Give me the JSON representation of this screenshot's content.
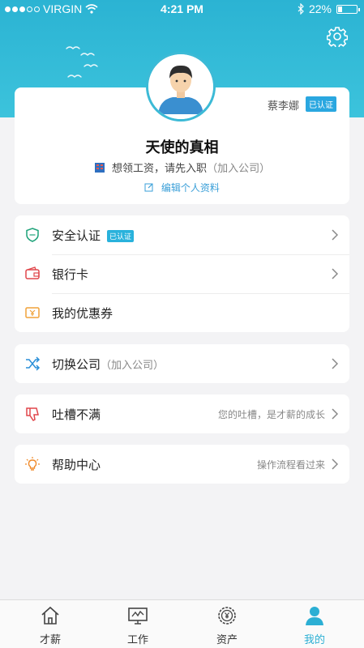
{
  "status_bar": {
    "carrier": "VIRGIN",
    "time": "4:21 PM",
    "battery": "22%",
    "battery_level": 0.22
  },
  "profile": {
    "real_name": "蔡李娜",
    "verified_tag": "已认证",
    "nickname": "天使的真相",
    "job_prompt": "想领工资，请先入职",
    "job_action": "（加入公司）",
    "edit_label": "编辑个人资料"
  },
  "group1": [
    {
      "label": "安全认证",
      "badge": "已认证",
      "icon": "shield-icon"
    },
    {
      "label": "银行卡",
      "icon": "wallet-icon"
    },
    {
      "label": "我的优惠券",
      "icon": "coupon-icon"
    }
  ],
  "group2": {
    "label": "切换公司",
    "hint": "（加入公司）",
    "icon": "shuffle-icon"
  },
  "group3": {
    "label": "吐槽不满",
    "right": "您的吐槽，是才薪的成长",
    "icon": "thumbs-down-icon"
  },
  "group4": {
    "label": "帮助中心",
    "right": "操作流程看过来",
    "icon": "lightbulb-icon"
  },
  "tabs": [
    {
      "label": "才薪",
      "icon": "home-icon"
    },
    {
      "label": "工作",
      "icon": "monitor-icon"
    },
    {
      "label": "资产",
      "icon": "yuan-gear-icon"
    },
    {
      "label": "我的",
      "icon": "person-icon",
      "active": true
    }
  ],
  "colors": {
    "accent": "#2bb3d3",
    "badge": "#2aa7e0",
    "link": "#3a9fd8"
  }
}
